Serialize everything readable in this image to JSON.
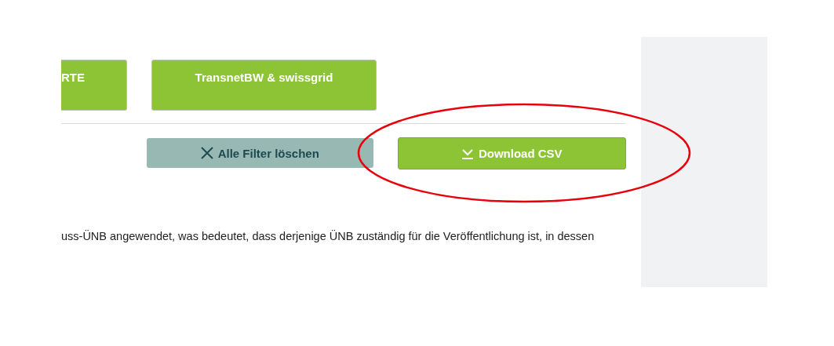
{
  "filter_buttons": [
    {
      "label": "RTE"
    },
    {
      "label": "TransnetBW & swissgrid"
    }
  ],
  "actions": [
    {
      "kind": "clear",
      "label": "Alle Filter löschen"
    },
    {
      "kind": "download",
      "label": "Download CSV"
    }
  ],
  "paragraph": "uss-ÜNB angewendet, was bedeutet, dass derjenige ÜNB zuständig für die Veröffentlichung ist, in dessen"
}
